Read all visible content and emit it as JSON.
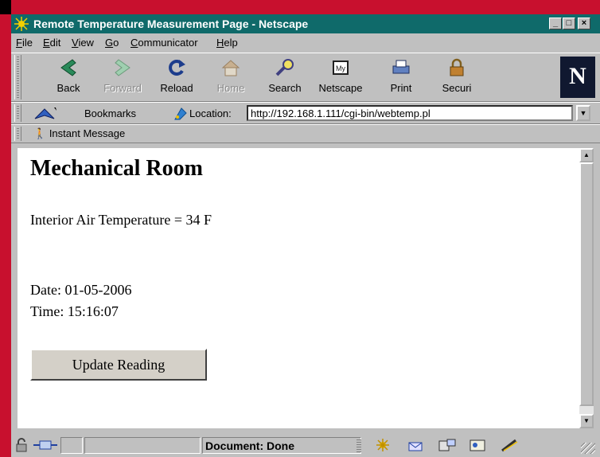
{
  "window": {
    "title": "Remote Temperature Measurement Page - Netscape"
  },
  "menu": [
    "File",
    "Edit",
    "View",
    "Go",
    "Communicator",
    "Help"
  ],
  "toolbar": {
    "back": "Back",
    "forward": "Forward",
    "reload": "Reload",
    "home": "Home",
    "search": "Search",
    "netscape": "Netscape",
    "print": "Print",
    "security": "Securi"
  },
  "location": {
    "bookmarks_label": "Bookmarks",
    "location_label": "Location:",
    "url": "http://192.168.1.111/cgi-bin/webtemp.pl"
  },
  "personal": {
    "instant_message": "Instant Message"
  },
  "page": {
    "heading": "Mechanical Room",
    "temperature": "Interior Air Temperature = 34 F",
    "date": "Date: 01-05-2006",
    "time": "Time: 15:16:07",
    "button": "Update Reading"
  },
  "status": {
    "text": "Document: Done"
  },
  "colors": {
    "titlebar": "#0f6a6a",
    "backdrop": "#c8102e",
    "chrome": "#c0c0c0"
  }
}
